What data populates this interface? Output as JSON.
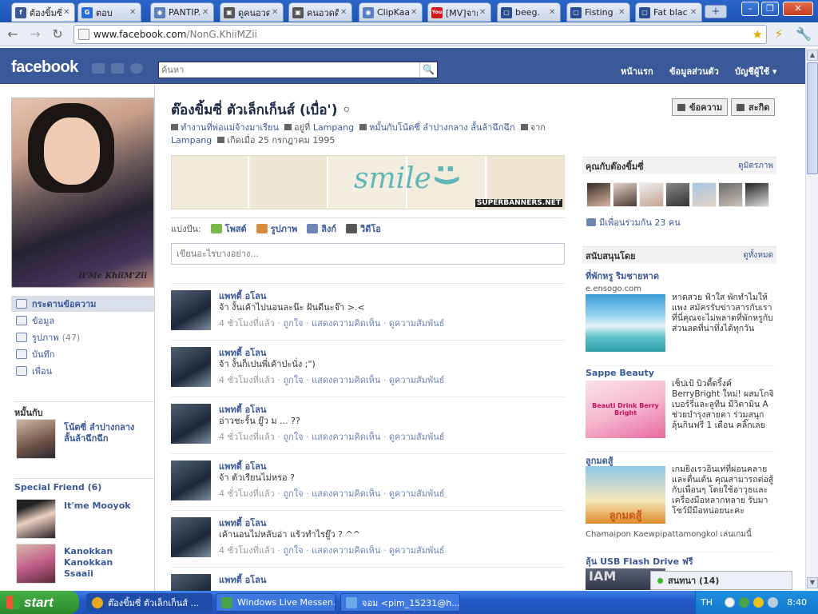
{
  "browser": {
    "tabs": [
      {
        "title": "ต้องขิ้มซี่",
        "fav": "facebook-icon",
        "favcolor": "#3b5998",
        "favtext": "f"
      },
      {
        "title": "ตอบ",
        "fav": "gameindy-icon",
        "favcolor": "#2b6bd6",
        "favtext": "G"
      },
      {
        "title": "PANTIP.",
        "fav": "globe-icon",
        "favcolor": "#5a7fbf",
        "favtext": "◉"
      },
      {
        "title": "ดูคนอวด",
        "fav": "page-icon",
        "favcolor": "#555",
        "favtext": "▣"
      },
      {
        "title": "คนอวดดี",
        "fav": "page-icon",
        "favcolor": "#555",
        "favtext": "▣"
      },
      {
        "title": "ClipKaa",
        "fav": "globe-icon",
        "favcolor": "#5a7fbf",
        "favtext": "◉"
      },
      {
        "title": "[MV]จาก",
        "fav": "youtube-icon",
        "favcolor": "#cc181e",
        "favtext": "You"
      },
      {
        "title": "beeg.",
        "fav": "page-icon",
        "favcolor": "#2a4d8f",
        "favtext": "▢"
      },
      {
        "title": "Fisting a",
        "fav": "page-icon",
        "favcolor": "#2a4d8f",
        "favtext": "▢"
      },
      {
        "title": "Fat blac",
        "fav": "page-icon",
        "favcolor": "#2a4d8f",
        "favtext": "▢"
      }
    ],
    "url_host": "www.facebook.com",
    "url_path": "/NonG.KhiiMZii"
  },
  "fb": {
    "logo": "facebook",
    "search_placeholder": "ค้นหา",
    "nav": [
      "หน้าแรก",
      "ข้อมูลส่วนตัว",
      "บัญชีผู้ใช้ ▾"
    ]
  },
  "profile": {
    "name": "ต๊องขิ้มซี่ ตัวเล็กเก็นส์ (เบื่อ') ◦",
    "photo_caption": "It'Me KhiiM'Zii",
    "work": "ทำงานที่พ่อแม่จ้างมาเรียน",
    "lives": "อยู่ที่ Lampang",
    "relationship": "หมั้นกับโน้ตซี่ ลำปางกลาง ลั้นล้าฉึกฉึก",
    "from_label": "จาก",
    "from": "Lampang",
    "born": "เกิดเมื่อ 25 กรกฎาคม 1995",
    "btn_message": "ข้อความ",
    "btn_poke": "สะกิด",
    "banner_text": "smile",
    "banner_face": ":)",
    "banner_credit": "SUPERBANNERS.NET"
  },
  "left_nav": [
    {
      "label": "กระดานข้อความ",
      "count": ""
    },
    {
      "label": "ข้อมูล",
      "count": ""
    },
    {
      "label": "รูปภาพ",
      "count": "(47)"
    },
    {
      "label": "บันทึก",
      "count": ""
    },
    {
      "label": "เพื่อน",
      "count": ""
    }
  ],
  "engaged": {
    "title": "หมั้นกับ",
    "name": "โน้ตซี่ ลำปางกลาง ลั้นล้าฉึกฉึก"
  },
  "special": {
    "title": "Special Friend (6)",
    "friends": [
      "It'me Mooyok",
      "Kanokkan Kanokkan Ssaaii"
    ]
  },
  "share": {
    "label": "แบ่งปัน:",
    "items": [
      "โพสต์",
      "รูปภาพ",
      "ลิงก์",
      "วิดีโอ"
    ],
    "composer_placeholder": "เขียนอะไรบางอย่าง..."
  },
  "posts": [
    {
      "name": "แพทตี้ อโลน",
      "text": "จ้า งั้นเค้าไปนอนละน๊ะ ฝันดีนะจ๊า >.<",
      "time": "4 ชั่วโมงที่แล้ว",
      "like": "ถูกใจ",
      "comment": "แสดงความคิดเห็น",
      "rel": "ดูความสัมพันธ์"
    },
    {
      "name": "แพทตี้ อโลน",
      "text": "จ้า งั้นก็เปนพี่เค้าป่ะนั่ง ;\")",
      "time": "4 ชั่วโมงที่แล้ว",
      "like": "ถูกใจ",
      "comment": "แสดงความคิดเห็น",
      "rel": "ดูความสัมพันธ์"
    },
    {
      "name": "แพทตี้ อโลน",
      "text": "อ่าวชะรั้น ยู๊ว ม ... ??",
      "time": "4 ชั่วโมงที่แล้ว",
      "like": "ถูกใจ",
      "comment": "แสดงความคิดเห็น",
      "rel": "ดูความสัมพันธ์"
    },
    {
      "name": "แพทตี้ อโลน",
      "text": "จ้า ตัวเรียนไม่หรอ ?",
      "time": "4 ชั่วโมงที่แล้ว",
      "like": "ถูกใจ",
      "comment": "แสดงความคิดเห็น",
      "rel": "ดูความสัมพันธ์"
    },
    {
      "name": "แพทตี้ อโลน",
      "text": "เค้านอนไม่หลับอ่า แร้วทำไรยู๊ว ? ^^",
      "time": "4 ชั่วโมงที่แล้ว",
      "like": "ถูกใจ",
      "comment": "แสดงความคิดเห็น",
      "rel": "ดูความสัมพันธ์"
    },
    {
      "name": "แพทตี้ อโลน",
      "text": "",
      "time": "",
      "like": "",
      "comment": "",
      "rel": ""
    }
  ],
  "right": {
    "mutual_title": "คุณกับต๊องขิ้มซี่",
    "mutual_link": "ดูมิตรภาพ",
    "mutual_count": "มีเพื่อนร่วมกัน 23 คน",
    "ads_title": "สนับสนุนโดย",
    "ads_link": "ดูทั้งหมด",
    "ads": [
      {
        "title": "ที่พักหรู ริมชายหาด",
        "url": "e.ensogo.com",
        "body": "หาดสวย ฟ้าใส พักทำไมให้แพง สมัครรับข่าวสารกับเราที่นี่คุณจะไม่พลาดที่พักหรูกับส่วนลดที่น่าทึ่งได้ทุกวัน"
      },
      {
        "title": "Sappe Beauty",
        "url": "",
        "body": "เช็ปเป้ บิวตี้ดริ้งค์ BerryBright ใหม่! ผสมโกจิเบอร์รี่และลูทีน มีวิตามิน A ช่วยบำรุงสายตา ร่วมสนุกลุ้นกินฟรี 1 เดือน คลิ๊กเลย",
        "img_label": "Beauti Drink Berry Bright"
      },
      {
        "title": "ลูกมดสู้",
        "url": "",
        "body": "เกมยิงเรวอินเท่ที่ผ่อนคลายและตื่นเต้น คุณสามารถต่อสู้กับเพื่อนๆ โดยใช้อาวุธและเครื่องมือหลากหลาย รับมาโชว์มีมือหน่อยนะคะ",
        "img_label": "ลูกมดสู้",
        "social": "Chamaipon Kaewpipattamongkol เล่นเกมนี้"
      },
      {
        "title": "ลุ้น USB Flash Drive ฟรี",
        "url": "",
        "body": "",
        "img_label": "IAM"
      }
    ],
    "chat_label": "สนทนา (14)"
  },
  "taskbar": {
    "start": "start",
    "tasks": [
      {
        "label": "ต๊องขิ้มซี่ ตัวเล็กเก็นส์ ...",
        "icon": "chrome-icon",
        "color": "#e8a81c"
      },
      {
        "label": "Windows Live Messen...",
        "icon": "messenger-icon",
        "color": "#4aa34a"
      },
      {
        "label": "จอม <pim_15231@h...",
        "icon": "chat-window-icon",
        "color": "#6aa6e8"
      }
    ],
    "lang": "TH",
    "clock": "8:40"
  },
  "colors": {
    "fb_blue": "#3b5998",
    "link": "#3b5998",
    "taskbar": "#235bc8"
  }
}
